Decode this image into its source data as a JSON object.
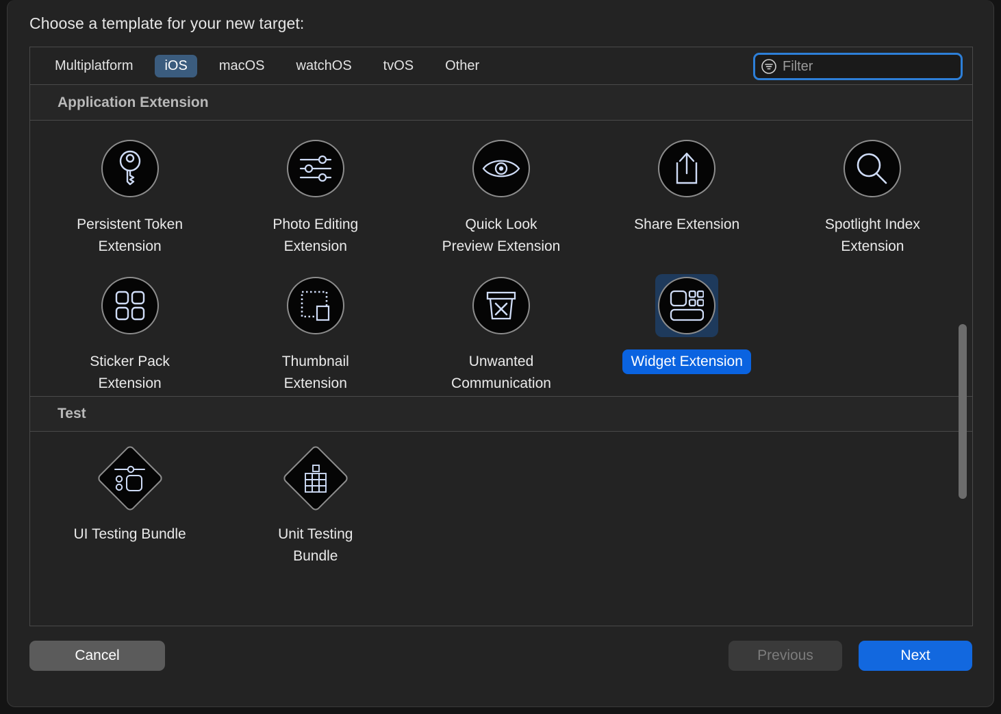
{
  "dialog": {
    "title": "Choose a template for your new target:"
  },
  "tabs": [
    {
      "label": "Multiplatform",
      "selected": false
    },
    {
      "label": "iOS",
      "selected": true
    },
    {
      "label": "macOS",
      "selected": false
    },
    {
      "label": "watchOS",
      "selected": false
    },
    {
      "label": "tvOS",
      "selected": false
    },
    {
      "label": "Other",
      "selected": false
    }
  ],
  "filter": {
    "icon": "filter-icon",
    "value": "",
    "placeholder": "Filter",
    "focused": true,
    "focus_ring_color": "#2d7fd8"
  },
  "sections": [
    {
      "header": "Application Extension",
      "items": [
        {
          "name": "Persistent Token Extension",
          "lines": [
            "Persistent Token",
            "Extension"
          ],
          "icon": "key-icon",
          "shape": "circle",
          "selected": false
        },
        {
          "name": "Photo Editing Extension",
          "lines": [
            "Photo Editing",
            "Extension"
          ],
          "icon": "sliders-icon",
          "shape": "circle",
          "selected": false
        },
        {
          "name": "Quick Look Preview Extension",
          "lines": [
            "Quick Look",
            "Preview Extension"
          ],
          "icon": "eye-icon",
          "shape": "circle",
          "selected": false
        },
        {
          "name": "Share Extension",
          "lines": [
            "Share Extension"
          ],
          "icon": "share-icon",
          "shape": "circle",
          "selected": false
        },
        {
          "name": "Spotlight Index Extension",
          "lines": [
            "Spotlight Index",
            "Extension"
          ],
          "icon": "magnifier-icon",
          "shape": "circle",
          "selected": false
        },
        {
          "name": "Sticker Pack Extension",
          "lines": [
            "Sticker Pack",
            "Extension"
          ],
          "icon": "grid-four-icon",
          "shape": "circle",
          "selected": false
        },
        {
          "name": "Thumbnail Extension",
          "lines": [
            "Thumbnail",
            "Extension"
          ],
          "icon": "thumbnail-icon",
          "shape": "circle",
          "selected": false
        },
        {
          "name": "Unwanted Communication",
          "lines": [
            "Unwanted",
            "Communication"
          ],
          "icon": "blocked-box-icon",
          "shape": "circle",
          "selected": false
        },
        {
          "name": "Widget Extension",
          "lines": [
            "Widget Extension"
          ],
          "icon": "widget-icon",
          "shape": "circle",
          "selected": true
        }
      ]
    },
    {
      "header": "Test",
      "items": [
        {
          "name": "UI Testing Bundle",
          "lines": [
            "UI Testing Bundle"
          ],
          "icon": "ui-test-icon",
          "shape": "diamond",
          "selected": false
        },
        {
          "name": "Unit Testing Bundle",
          "lines": [
            "Unit Testing",
            "Bundle"
          ],
          "icon": "unit-test-icon",
          "shape": "diamond",
          "selected": false
        }
      ]
    }
  ],
  "scrollbar": {
    "orientation": "vertical",
    "thumb_color": "#6c6c6c"
  },
  "footer": {
    "cancel_label": "Cancel",
    "previous_label": "Previous",
    "previous_disabled": true,
    "next_label": "Next",
    "next_accent": "#1268df"
  },
  "colors": {
    "selection_blue": "#0a63e0",
    "tab_selected": "#3b5c7e",
    "icon_stroke": "#cfdcf7",
    "panel_border": "#4a4a4a"
  }
}
